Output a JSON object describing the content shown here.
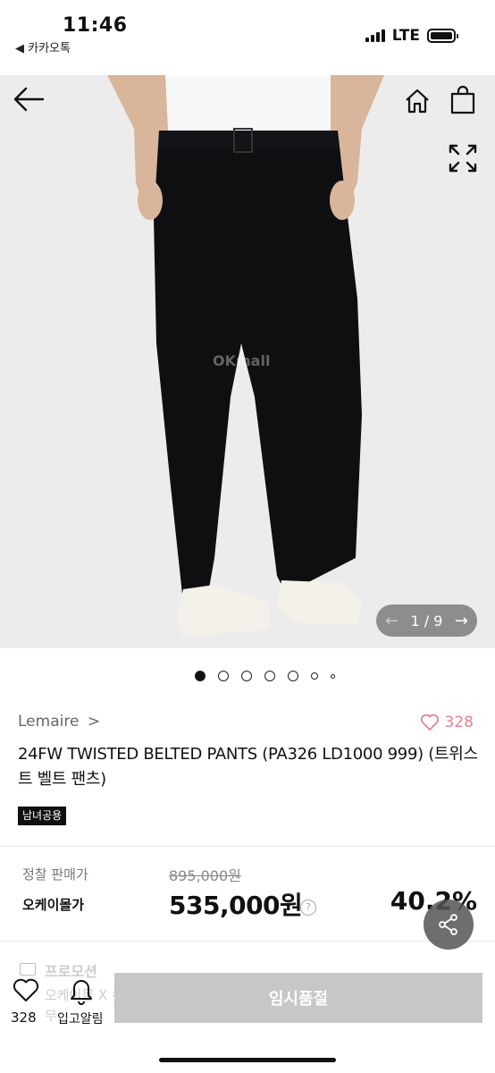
{
  "status_bar": {
    "time": "11:46",
    "back_app": "◀ 카카오톡",
    "network": "LTE"
  },
  "hero": {
    "watermark": "OKmall",
    "pager_current": "1",
    "pager_total": "9",
    "pager_text": "1 / 9",
    "icons": [
      "back-arrow-icon",
      "home-icon",
      "shopping-bag-icon",
      "fullscreen-icon"
    ]
  },
  "carousel": {
    "dot_count": 7,
    "active_index": 0
  },
  "product": {
    "brand": "Lemaire",
    "brand_chevron": ">",
    "like_count": "328",
    "title": "24FW   TWISTED BELTED PANTS (PA326 LD1000 999) (트위스트 벨트 팬츠)",
    "gender_tag": "남녀공용"
  },
  "price": {
    "original_label": "정찰 판매가",
    "original_price": "895,000원",
    "sale_label": "오케이몰가",
    "sale_price": "535,000원",
    "help_symbol": "?",
    "discount": "40.2%"
  },
  "promotion": {
    "title": "프로모션",
    "line1": "오케이몰 X 롯",
    "line2": "무"
  },
  "bottom_bar": {
    "like_count": "328",
    "restock_label": "입고알림",
    "sold_out_label": "임시품절"
  }
}
